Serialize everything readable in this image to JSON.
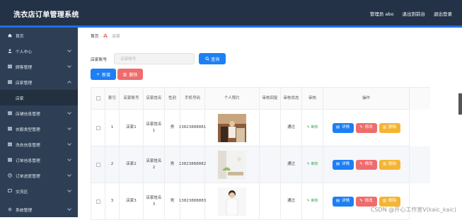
{
  "header": {
    "title": "洗衣店订单管理系统",
    "user_label": "管理员 abo",
    "goto_frontend": "退出到前台",
    "logout": "退出登录"
  },
  "sidebar": {
    "items": [
      {
        "label": "首页",
        "icon": "home-icon"
      },
      {
        "label": "个人中心",
        "icon": "user-icon"
      },
      {
        "label": "顾客管理",
        "icon": "grid-icon"
      },
      {
        "label": "店家管理",
        "icon": "grid-icon"
      },
      {
        "label": "店家",
        "icon": ""
      },
      {
        "label": "店铺信息管理",
        "icon": "grid-icon"
      },
      {
        "label": "衣服类型管理",
        "icon": "grid-icon"
      },
      {
        "label": "洗衣信息管理",
        "icon": "grid-icon"
      },
      {
        "label": "订单信息管理",
        "icon": "grid-icon"
      },
      {
        "label": "订单进度管理",
        "icon": "clock-icon"
      },
      {
        "label": "交流区",
        "icon": "chat-icon"
      },
      {
        "label": "系统管理",
        "icon": "gear-icon"
      }
    ]
  },
  "breadcrumb": {
    "home": "首页",
    "current": "店家"
  },
  "search": {
    "label": "店家账号",
    "placeholder": "店家账号",
    "button": "查询"
  },
  "toolbar": {
    "add": "新增",
    "delete": "删除"
  },
  "table": {
    "headers": [
      "索引",
      "店家账号",
      "店家姓名",
      "性别",
      "手机号码",
      "个人照片",
      "审核回复",
      "审核状态",
      "审核",
      "操作"
    ],
    "rows": [
      {
        "index": "1",
        "account": "店家1",
        "name": "店家姓名1",
        "gender": "男",
        "phone": "13823888881",
        "reply": "",
        "status": "通过",
        "audit": "审核"
      },
      {
        "index": "2",
        "account": "店家2",
        "name": "店家姓名2",
        "gender": "男",
        "phone": "13823888882",
        "reply": "",
        "status": "通过",
        "audit": "审核"
      },
      {
        "index": "3",
        "account": "店家3",
        "name": "店家姓名3",
        "gender": "男",
        "phone": "13823888883",
        "reply": "",
        "status": "通过",
        "audit": "审核"
      }
    ],
    "ops": {
      "detail": "详情",
      "edit": "修改",
      "delete": "删除"
    }
  },
  "watermark": "CSDN @开心工作室V(kaic_kaic)",
  "colors": {
    "header_bg": "#233246",
    "sidebar_bg": "#2e3f55",
    "accent": "#1d7ff5",
    "danger": "#ef6c6c",
    "warning": "#f4b532"
  }
}
